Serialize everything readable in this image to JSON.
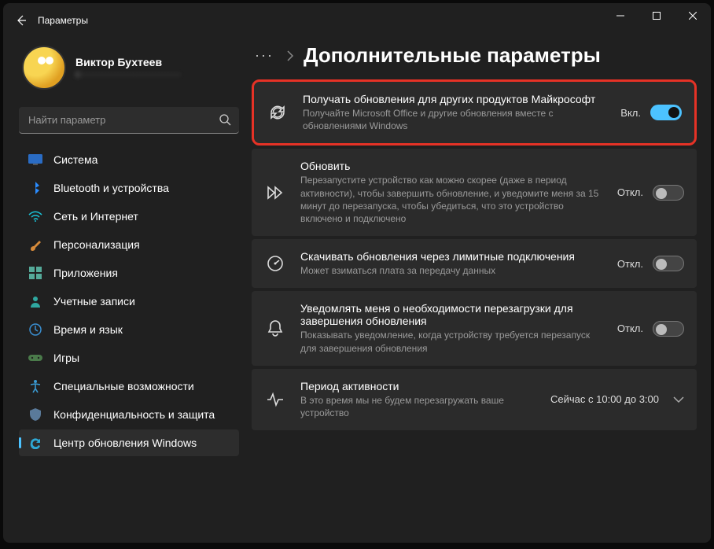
{
  "window": {
    "title": "Параметры"
  },
  "profile": {
    "name": "Виктор Бухтеев",
    "email": "c································"
  },
  "search": {
    "placeholder": "Найти параметр"
  },
  "nav": {
    "items": [
      {
        "label": "Система"
      },
      {
        "label": "Bluetooth и устройства"
      },
      {
        "label": "Сеть и Интернет"
      },
      {
        "label": "Персонализация"
      },
      {
        "label": "Приложения"
      },
      {
        "label": "Учетные записи"
      },
      {
        "label": "Время и язык"
      },
      {
        "label": "Игры"
      },
      {
        "label": "Специальные возможности"
      },
      {
        "label": "Конфиденциальность и защита"
      },
      {
        "label": "Центр обновления Windows"
      }
    ]
  },
  "breadcrumb": {
    "more": "···",
    "title": "Дополнительные параметры"
  },
  "cards": [
    {
      "title": "Получать обновления для других продуктов Майкрософт",
      "desc": "Получайте Microsoft Office и другие обновления вместе с обновлениями Windows",
      "toggle_label": "Вкл.",
      "toggle_on": true
    },
    {
      "title": "Обновить",
      "desc": "Перезапустите устройство как можно скорее (даже в период активности), чтобы завершить обновление, и уведомите меня за 15 минут до перезапуска, чтобы убедиться, что это устройство включено и подключено",
      "toggle_label": "Откл.",
      "toggle_on": false
    },
    {
      "title": "Скачивать обновления через лимитные подключения",
      "desc": "Может взиматься плата за передачу данных",
      "toggle_label": "Откл.",
      "toggle_on": false
    },
    {
      "title": "Уведомлять меня о необходимости перезагрузки для завершения обновления",
      "desc": "Показывать уведомление, когда устройству требуется перезапуск для завершения обновления",
      "toggle_label": "Откл.",
      "toggle_on": false
    },
    {
      "title": "Период активности",
      "desc": "В это время мы не будем перезагружать ваше устройство",
      "value": "Сейчас с 10:00 до 3:00"
    }
  ]
}
